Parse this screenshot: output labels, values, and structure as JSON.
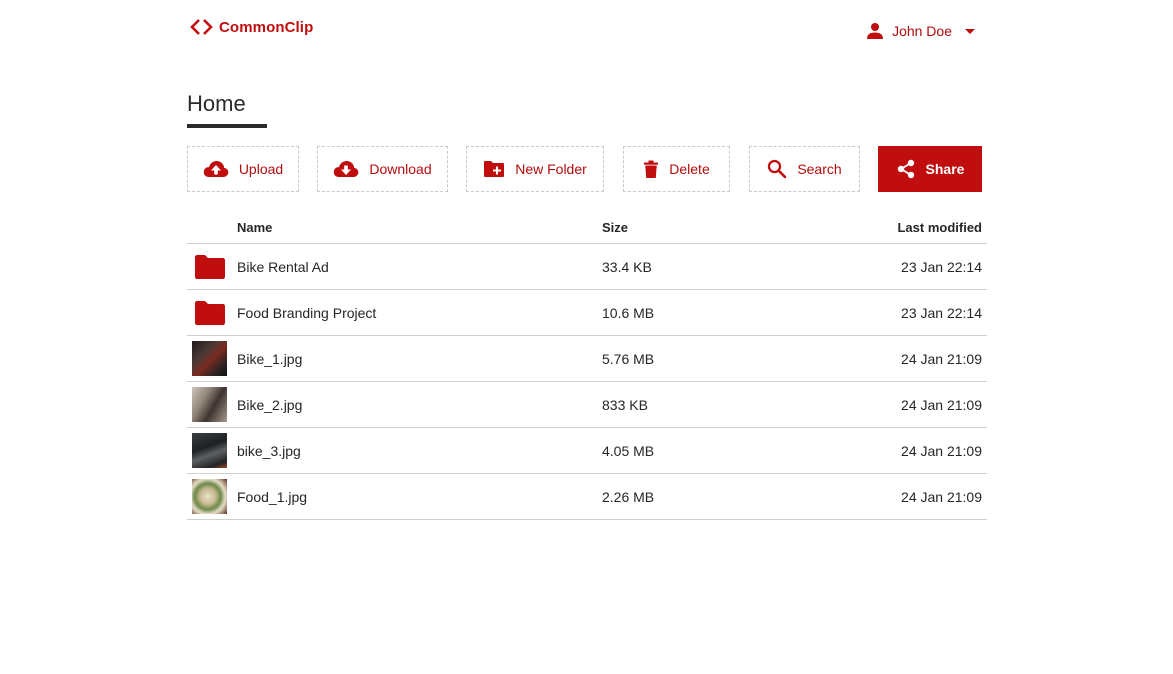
{
  "app": {
    "name": "CommonClip",
    "accent_color": "#c00d0d",
    "logo_icon": "code-brackets-icon"
  },
  "user": {
    "name": "John Doe",
    "icon": "user-icon",
    "menu_icon": "caret-down-icon"
  },
  "page": {
    "title": "Home"
  },
  "toolbar": {
    "upload_label": "Upload",
    "download_label": "Download",
    "new_folder_label": "New Folder",
    "delete_label": "Delete",
    "search_label": "Search",
    "share_label": "Share"
  },
  "table": {
    "columns": {
      "name": "Name",
      "size": "Size",
      "modified": "Last modified"
    },
    "rows": [
      {
        "type": "folder",
        "name": "Bike Rental Ad",
        "size": "33.4 KB",
        "modified": "23 Jan 22:14"
      },
      {
        "type": "folder",
        "name": "Food Branding Project",
        "size": "10.6 MB",
        "modified": "23 Jan 22:14"
      },
      {
        "type": "image",
        "name": "Bike_1.jpg",
        "size": "5.76 MB",
        "modified": "24 Jan 21:09"
      },
      {
        "type": "image",
        "name": "Bike_2.jpg",
        "size": "833 KB",
        "modified": "24 Jan 21:09"
      },
      {
        "type": "image",
        "name": "bike_3.jpg",
        "size": "4.05 MB",
        "modified": "24 Jan 21:09"
      },
      {
        "type": "image",
        "name": "Food_1.jpg",
        "size": "2.26 MB",
        "modified": "24 Jan 21:09"
      }
    ]
  }
}
